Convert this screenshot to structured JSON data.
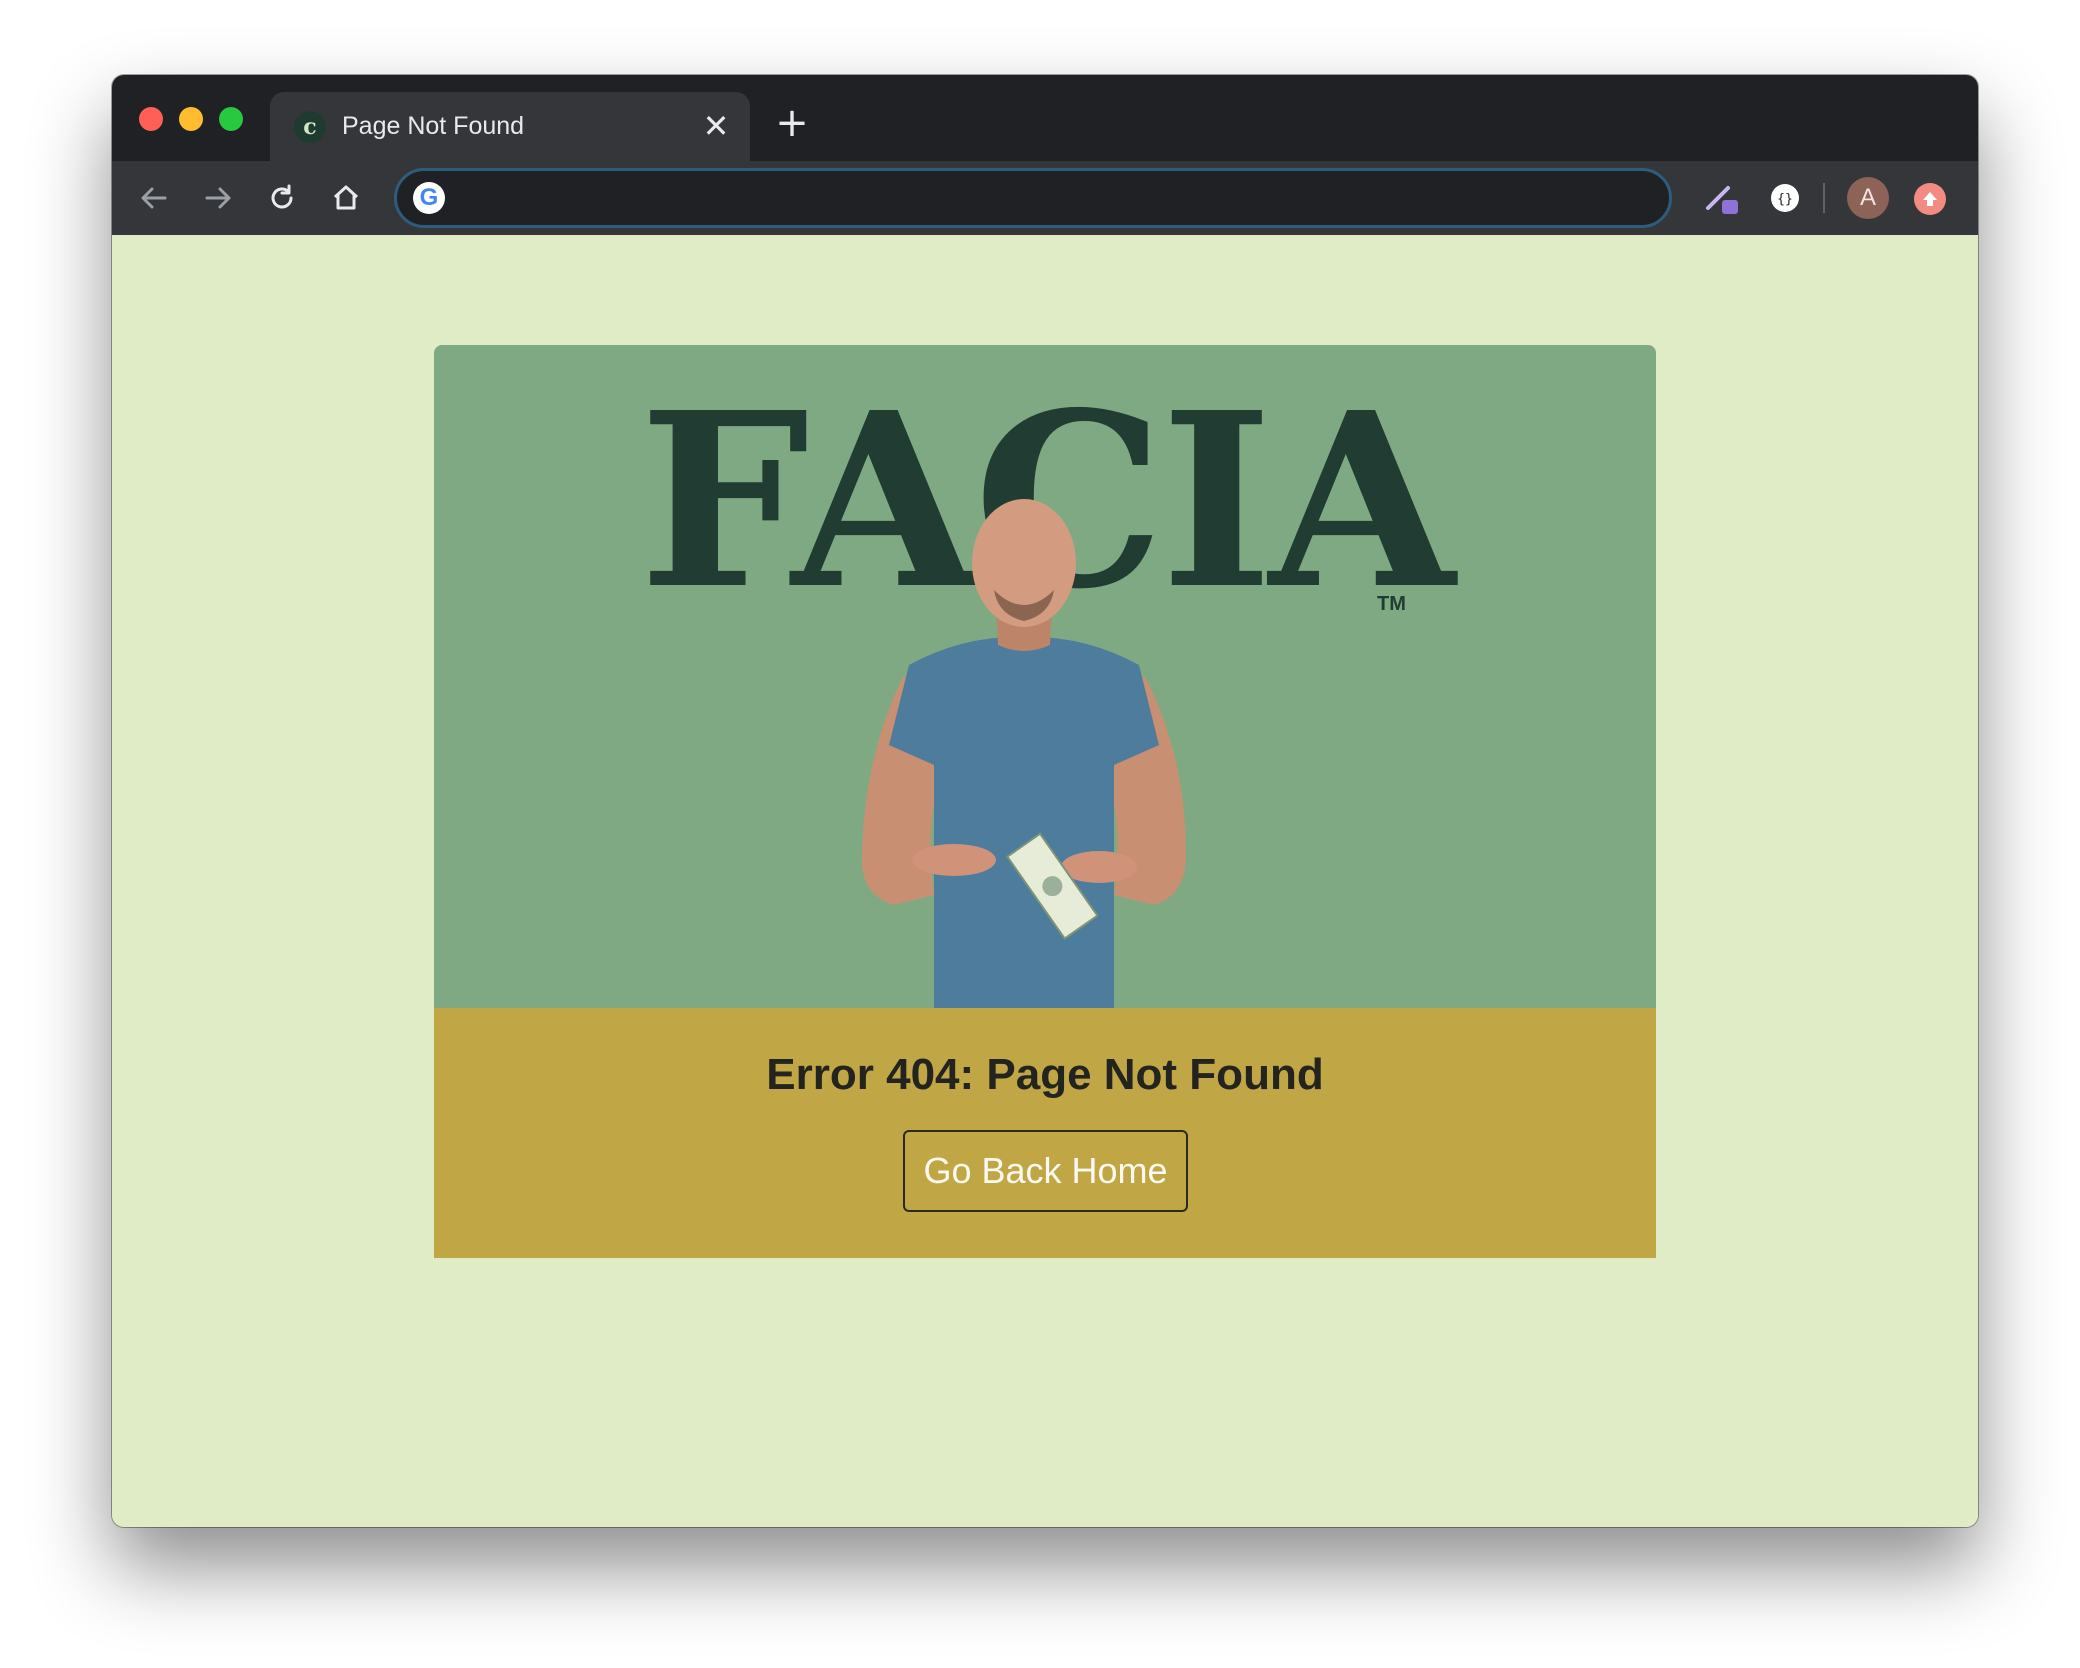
{
  "browser": {
    "tab": {
      "favicon_glyph": "c",
      "title": "Page Not Found",
      "close_glyph": "✕"
    },
    "new_tab_glyph": "+",
    "omnibox": {
      "value": "",
      "search_engine_glyph": "G"
    },
    "profile_initial": "A"
  },
  "page": {
    "logo_text": "FACIA",
    "logo_trademark": "TM",
    "error_title": "Error 404: Page Not Found",
    "home_button_label": "Go Back Home"
  },
  "colors": {
    "page_background": "#e0ecc6",
    "hero_background": "#7fa982",
    "logo_color": "#213c32",
    "error_band": "#c1a645",
    "button_text": "#fbfaf2"
  }
}
